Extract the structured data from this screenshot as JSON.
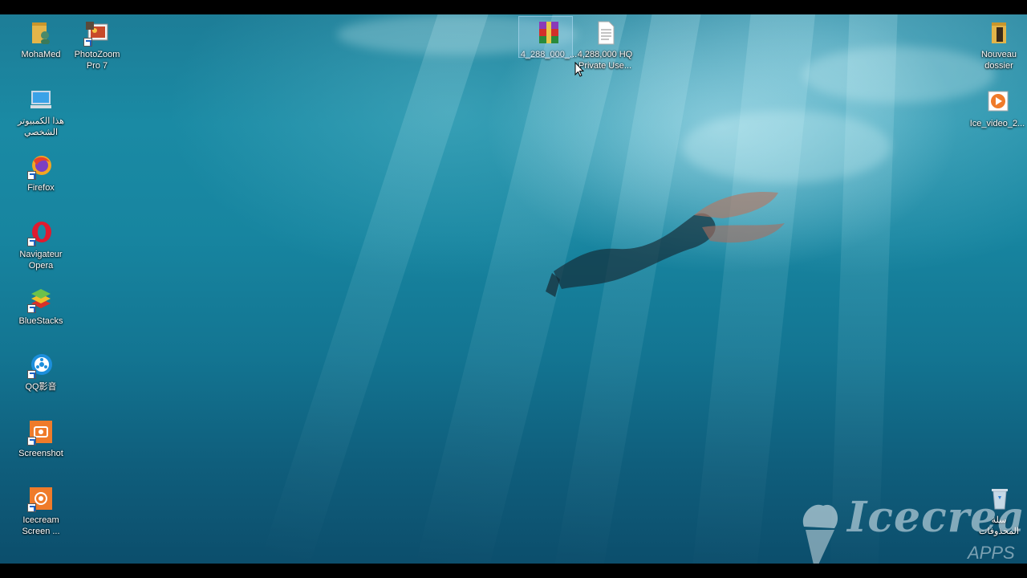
{
  "desktop": {
    "left_icons": [
      {
        "id": "mohamed",
        "label": "MohaMed",
        "icon": "user-folder-icon"
      },
      {
        "id": "photozoom",
        "label": "PhotoZoom\nPro 7",
        "icon": "photozoom-icon"
      },
      {
        "id": "this-pc",
        "label": "هذا الكمبيوتر\nالشخصي",
        "icon": "computer-icon"
      },
      {
        "id": "firefox",
        "label": "Firefox",
        "icon": "firefox-icon"
      },
      {
        "id": "opera",
        "label": "Navigateur\nOpera",
        "icon": "opera-icon"
      },
      {
        "id": "bluestacks",
        "label": "BlueStacks",
        "icon": "bluestacks-icon"
      },
      {
        "id": "qq",
        "label": "QQ影音",
        "icon": "qq-player-icon"
      },
      {
        "id": "screenshot",
        "label": "Screenshot",
        "icon": "icecream-screenshot-icon"
      },
      {
        "id": "icecream",
        "label": "Icecream\nScreen ...",
        "icon": "icecream-recorder-icon"
      }
    ],
    "top_icons": [
      {
        "id": "rar",
        "label": "4_288_000_...",
        "icon": "winrar-archive-icon",
        "selected": true
      },
      {
        "id": "txt",
        "label": "4,288,000 HQ\nPrivate Use...",
        "icon": "text-file-icon"
      }
    ],
    "right_icons": [
      {
        "id": "new-folder",
        "label": "Nouveau\ndossier",
        "icon": "folder-icon"
      },
      {
        "id": "video",
        "label": "Ice_video_2...",
        "icon": "video-file-icon"
      },
      {
        "id": "recycle",
        "label": "سلة\nالمحذوفات",
        "icon": "recycle-bin-icon"
      }
    ]
  },
  "watermark": {
    "brand": "Icecream",
    "sub": "APPS"
  },
  "colors": {
    "water_top": "#1d7d97",
    "water_bottom": "#0c4e6c",
    "label": "#ffffff"
  }
}
